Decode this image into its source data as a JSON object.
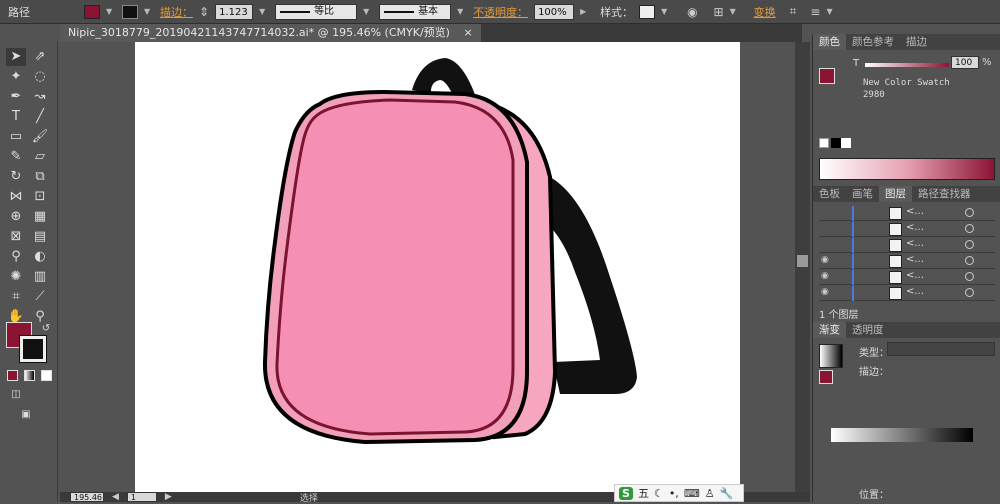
{
  "control_bar": {
    "path_label": "路径",
    "stroke_label": "描边：",
    "stroke_weight": "1.123",
    "profile_label": "等比",
    "brush_label": "基本",
    "opacity_label": "不透明度：",
    "opacity_value": "100%",
    "style_label": "样式：",
    "transform_label": "变换"
  },
  "document": {
    "tab_title": "Nipic_3018779_20190421143747714032.ai* @ 195.46% (CMYK/预览)",
    "close_glyph": "×"
  },
  "colors": {
    "fill": "#8c1433",
    "bag_pink": "#f59ab6",
    "bag_outline": "#7a1430",
    "strap": "#111111"
  },
  "color_panel": {
    "tabs": [
      "颜色",
      "颜色参考",
      "描边"
    ],
    "tint_prefix": "T",
    "tint_value": "100",
    "tint_unit": "%",
    "swatch_name": "New Color Swatch",
    "swatch_number": "2980"
  },
  "layers_panel": {
    "tabs": [
      "色板",
      "画笔",
      "图层",
      "路径查找器"
    ],
    "rows": [
      {
        "name": "<...",
        "visible": false
      },
      {
        "name": "<...",
        "visible": false
      },
      {
        "name": "<...",
        "visible": false
      },
      {
        "name": "<...",
        "visible": true
      },
      {
        "name": "<...",
        "visible": true
      },
      {
        "name": "<...",
        "visible": true
      }
    ],
    "footer": "1 个图层"
  },
  "gradient_panel": {
    "tabs": [
      "渐变",
      "透明度"
    ],
    "type_label": "类型：",
    "stroke_label": "描边：",
    "position_label": "位置："
  },
  "status_bar": {
    "zoom": "195.46",
    "page": "1",
    "tool_name": "选择"
  },
  "ime_bar": {
    "logo": "S",
    "mode": "五"
  }
}
